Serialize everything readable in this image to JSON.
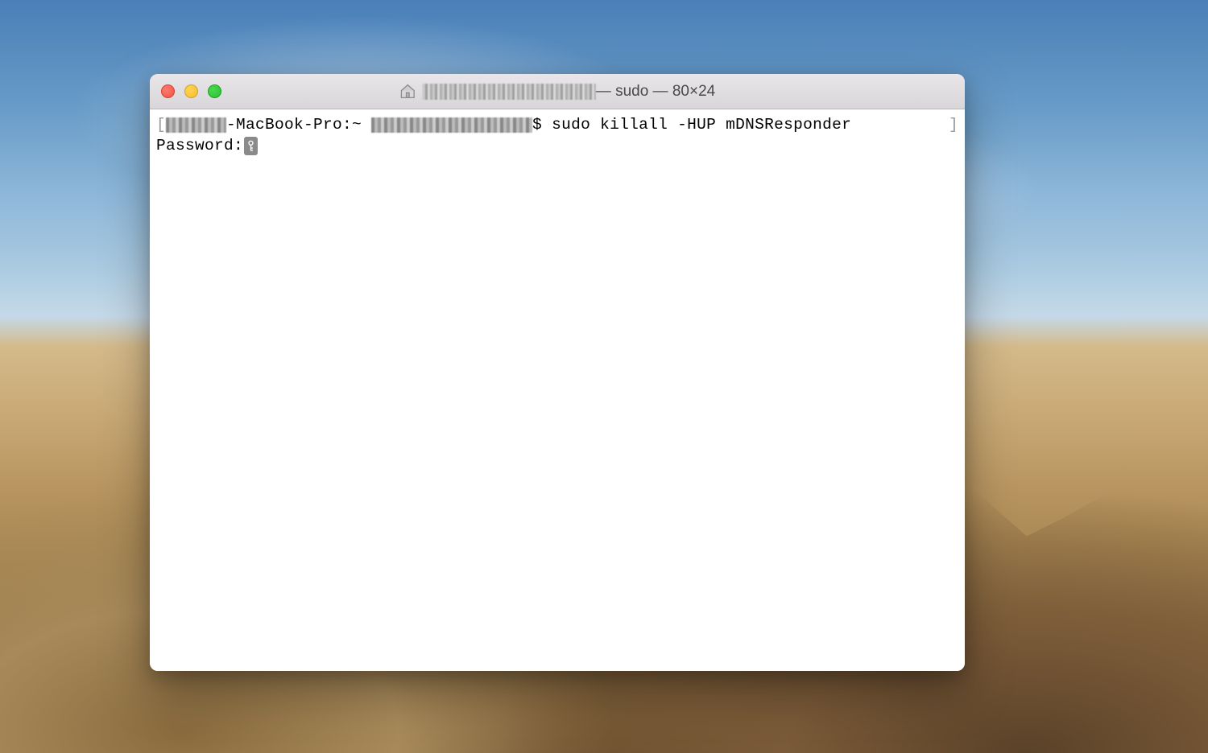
{
  "titlebar": {
    "title_suffix": " — sudo — 80×24"
  },
  "terminal": {
    "line1": {
      "bracket_open": "[",
      "host_suffix": "-MacBook-Pro:~ ",
      "prompt_suffix": "$ ",
      "command": "sudo killall -HUP mDNSResponder",
      "bracket_close": "]"
    },
    "line2": {
      "label": "Password:"
    }
  }
}
